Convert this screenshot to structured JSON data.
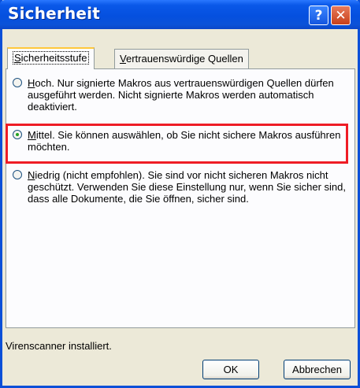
{
  "window": {
    "title": "Sicherheit",
    "help_label": "?",
    "close_label": "✕"
  },
  "tabs": [
    {
      "label_first": "S",
      "label_rest": "icherheitsstufe",
      "active": true
    },
    {
      "label_first": "V",
      "label_rest": "ertrauenswürdige Quellen",
      "active": false
    }
  ],
  "options": [
    {
      "key_letter": "H",
      "text_rest": "och. Nur signierte Makros aus vertrauenswürdigen Quellen dürfen ausgeführt werden.  Nicht signierte Makros werden automatisch deaktiviert.",
      "selected": false
    },
    {
      "key_letter": "M",
      "text_rest": "ittel. Sie können auswählen, ob Sie nicht sichere Makros ausführen möchten.",
      "selected": true
    },
    {
      "key_letter": "N",
      "text_rest": "iedrig (nicht empfohlen). Sie sind vor nicht sicheren Makros nicht geschützt. Verwenden Sie diese Einstellung nur, wenn Sie sicher sind, dass alle Dokumente, die Sie öffnen, sicher sind.",
      "selected": false
    }
  ],
  "status": "Virenscanner installiert.",
  "buttons": {
    "ok": "OK",
    "cancel": "Abbrechen"
  },
  "colors": {
    "titlebar": "#0550df",
    "highlight": "#ee1c25",
    "dialog_bg": "#ece9d8"
  }
}
